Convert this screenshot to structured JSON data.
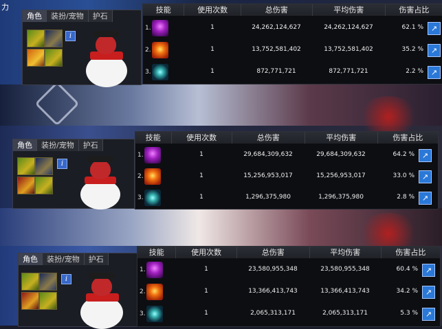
{
  "colors": {
    "accent_blue": "#2a78d8",
    "panel_bg": "#0d0e12",
    "header_bg": "#24262d"
  },
  "top_left_text": "力",
  "character_tabs": [
    "角色",
    "装扮/宠物",
    "护石"
  ],
  "panels": [
    {
      "headers": [
        "技能",
        "使用次数",
        "总伤害",
        "平均伤害",
        "伤害占比"
      ],
      "rows": [
        {
          "index": "1.",
          "icon": "purple-skill-icon",
          "uses": "1",
          "total": "24,262,124,627",
          "avg": "24,262,124,627",
          "pct": "62.1 %"
        },
        {
          "index": "2.",
          "icon": "fire-skill-icon",
          "uses": "1",
          "total": "13,752,581,402",
          "avg": "13,752,581,402",
          "pct": "35.2 %"
        },
        {
          "index": "3.",
          "icon": "swirl-skill-icon",
          "uses": "1",
          "total": "872,771,721",
          "avg": "872,771,721",
          "pct": "2.2 %"
        }
      ]
    },
    {
      "headers": [
        "技能",
        "使用次数",
        "总伤害",
        "平均伤害",
        "伤害占比"
      ],
      "rows": [
        {
          "index": "1.",
          "icon": "purple-skill-icon",
          "uses": "1",
          "total": "29,684,309,632",
          "avg": "29,684,309,632",
          "pct": "64.2 %"
        },
        {
          "index": "2.",
          "icon": "fire-skill-icon",
          "uses": "1",
          "total": "15,256,953,017",
          "avg": "15,256,953,017",
          "pct": "33.0 %"
        },
        {
          "index": "3.",
          "icon": "swirl-skill-icon",
          "uses": "1",
          "total": "1,296,375,980",
          "avg": "1,296,375,980",
          "pct": "2.8 %"
        }
      ]
    },
    {
      "headers": [
        "技能",
        "使用次数",
        "总伤害",
        "平均伤害",
        "伤害占比"
      ],
      "rows": [
        {
          "index": "1.",
          "icon": "purple-skill-icon",
          "uses": "1",
          "total": "23,580,955,348",
          "avg": "23,580,955,348",
          "pct": "60.4 %"
        },
        {
          "index": "2.",
          "icon": "fire-skill-icon",
          "uses": "1",
          "total": "13,366,413,743",
          "avg": "13,366,413,743",
          "pct": "34.2 %"
        },
        {
          "index": "3.",
          "icon": "swirl-skill-icon",
          "uses": "1",
          "total": "2,065,313,171",
          "avg": "2,065,313,171",
          "pct": "5.3 %"
        }
      ]
    }
  ],
  "info_glyph": "i",
  "share_glyph": "↗"
}
